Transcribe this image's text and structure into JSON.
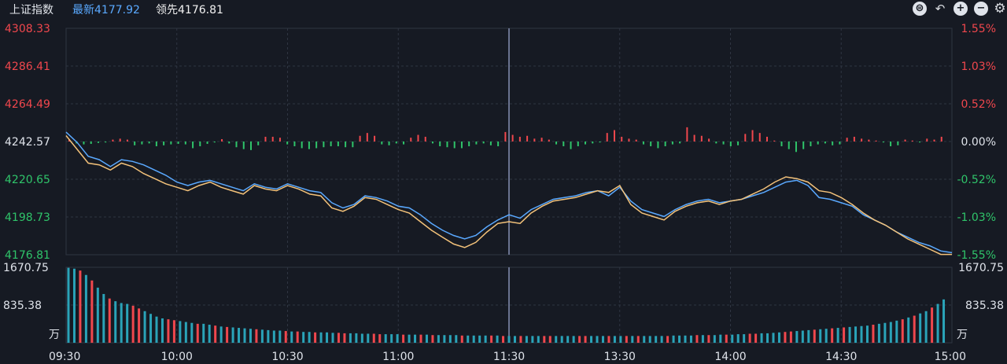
{
  "header": {
    "title": "上证指数",
    "latest_label": "最新4177.92",
    "leading_label": "领先4176.81"
  },
  "toolbar": {
    "icons": [
      "scale-icon",
      "undo-icon",
      "zoom-in-icon",
      "zoom-out-icon",
      "settings-icon"
    ]
  },
  "colors": {
    "background": "#161a23",
    "up": "#f0474d",
    "down": "#2fc46a",
    "index_line": "#5aa9ff",
    "leading_line": "#f3c27a",
    "volume": "#2aa3b8",
    "grid": "#2f3542"
  },
  "chart_data": {
    "type": "line",
    "price_axis": {
      "ticks_left": [
        "4308.33",
        "4286.41",
        "4264.49",
        "4242.57",
        "4220.65",
        "4198.73",
        "4176.81"
      ],
      "ticks_right": [
        "1.55%",
        "1.03%",
        "0.52%",
        "0.00%",
        "-0.52%",
        "-1.03%",
        "-1.55%"
      ],
      "ylim": [
        4176.81,
        4308.33
      ],
      "base": 4242.57
    },
    "volume_axis": {
      "ticks": [
        "1670.75",
        "835.38"
      ],
      "unit": "万",
      "ylim": [
        0,
        1670.75
      ]
    },
    "x_ticks": [
      "09:30",
      "10:00",
      "10:30",
      "11:00",
      "11:30",
      "13:30",
      "14:00",
      "14:30",
      "15:00"
    ],
    "x_minutes": [
      0,
      30,
      60,
      90,
      120,
      150,
      180,
      210,
      240
    ],
    "series": [
      {
        "name": "最新",
        "points": [
          [
            0,
            4248
          ],
          [
            3,
            4242
          ],
          [
            6,
            4234
          ],
          [
            9,
            4232
          ],
          [
            12,
            4228
          ],
          [
            15,
            4232
          ],
          [
            18,
            4231
          ],
          [
            21,
            4229
          ],
          [
            24,
            4226
          ],
          [
            27,
            4223
          ],
          [
            30,
            4219
          ],
          [
            33,
            4217
          ],
          [
            36,
            4219
          ],
          [
            39,
            4220
          ],
          [
            42,
            4218
          ],
          [
            45,
            4216
          ],
          [
            48,
            4214
          ],
          [
            51,
            4218
          ],
          [
            54,
            4216
          ],
          [
            57,
            4215
          ],
          [
            60,
            4218
          ],
          [
            63,
            4216
          ],
          [
            66,
            4214
          ],
          [
            69,
            4213
          ],
          [
            72,
            4207
          ],
          [
            75,
            4204
          ],
          [
            78,
            4206
          ],
          [
            81,
            4211
          ],
          [
            84,
            4210
          ],
          [
            87,
            4208
          ],
          [
            90,
            4205
          ],
          [
            93,
            4204
          ],
          [
            96,
            4200
          ],
          [
            99,
            4195
          ],
          [
            102,
            4191
          ],
          [
            105,
            4188
          ],
          [
            108,
            4186
          ],
          [
            111,
            4188
          ],
          [
            114,
            4193
          ],
          [
            117,
            4197
          ],
          [
            120,
            4200
          ],
          [
            123,
            4198
          ],
          [
            126,
            4203
          ],
          [
            129,
            4206
          ],
          [
            132,
            4209
          ],
          [
            135,
            4210
          ],
          [
            138,
            4211
          ],
          [
            141,
            4213
          ],
          [
            144,
            4214
          ],
          [
            147,
            4211
          ],
          [
            150,
            4216
          ],
          [
            153,
            4208
          ],
          [
            156,
            4203
          ],
          [
            159,
            4201
          ],
          [
            162,
            4199
          ],
          [
            165,
            4203
          ],
          [
            168,
            4206
          ],
          [
            171,
            4208
          ],
          [
            174,
            4209
          ],
          [
            177,
            4207
          ],
          [
            180,
            4208
          ],
          [
            183,
            4209
          ],
          [
            186,
            4211
          ],
          [
            189,
            4213
          ],
          [
            192,
            4216
          ],
          [
            195,
            4219
          ],
          [
            198,
            4220
          ],
          [
            201,
            4217
          ],
          [
            204,
            4210
          ],
          [
            207,
            4209
          ],
          [
            210,
            4207
          ],
          [
            213,
            4205
          ],
          [
            216,
            4200
          ],
          [
            219,
            4197
          ],
          [
            222,
            4194
          ],
          [
            225,
            4190
          ],
          [
            228,
            4187
          ],
          [
            231,
            4184
          ],
          [
            234,
            4182
          ],
          [
            237,
            4179
          ],
          [
            240,
            4178
          ]
        ]
      },
      {
        "name": "领先",
        "points": [
          [
            0,
            4246
          ],
          [
            3,
            4238
          ],
          [
            6,
            4230
          ],
          [
            9,
            4229
          ],
          [
            12,
            4226
          ],
          [
            15,
            4230
          ],
          [
            18,
            4228
          ],
          [
            21,
            4224
          ],
          [
            24,
            4221
          ],
          [
            27,
            4218
          ],
          [
            30,
            4216
          ],
          [
            33,
            4214
          ],
          [
            36,
            4217
          ],
          [
            39,
            4219
          ],
          [
            42,
            4216
          ],
          [
            45,
            4214
          ],
          [
            48,
            4212
          ],
          [
            51,
            4217
          ],
          [
            54,
            4215
          ],
          [
            57,
            4214
          ],
          [
            60,
            4217
          ],
          [
            63,
            4215
          ],
          [
            66,
            4212
          ],
          [
            69,
            4211
          ],
          [
            72,
            4204
          ],
          [
            75,
            4202
          ],
          [
            78,
            4205
          ],
          [
            81,
            4210
          ],
          [
            84,
            4209
          ],
          [
            87,
            4206
          ],
          [
            90,
            4203
          ],
          [
            93,
            4201
          ],
          [
            96,
            4196
          ],
          [
            99,
            4191
          ],
          [
            102,
            4187
          ],
          [
            105,
            4183
          ],
          [
            108,
            4181
          ],
          [
            111,
            4184
          ],
          [
            114,
            4190
          ],
          [
            117,
            4195
          ],
          [
            120,
            4196
          ],
          [
            123,
            4195
          ],
          [
            126,
            4201
          ],
          [
            129,
            4205
          ],
          [
            132,
            4208
          ],
          [
            135,
            4209
          ],
          [
            138,
            4210
          ],
          [
            141,
            4212
          ],
          [
            144,
            4214
          ],
          [
            147,
            4213
          ],
          [
            150,
            4217
          ],
          [
            153,
            4206
          ],
          [
            156,
            4201
          ],
          [
            159,
            4199
          ],
          [
            162,
            4197
          ],
          [
            165,
            4202
          ],
          [
            168,
            4205
          ],
          [
            171,
            4207
          ],
          [
            174,
            4208
          ],
          [
            177,
            4206
          ],
          [
            180,
            4208
          ],
          [
            183,
            4209
          ],
          [
            186,
            4212
          ],
          [
            189,
            4215
          ],
          [
            192,
            4219
          ],
          [
            195,
            4222
          ],
          [
            198,
            4221
          ],
          [
            201,
            4219
          ],
          [
            204,
            4214
          ],
          [
            207,
            4213
          ],
          [
            210,
            4210
          ],
          [
            213,
            4206
          ],
          [
            216,
            4201
          ],
          [
            219,
            4197
          ],
          [
            222,
            4194
          ],
          [
            225,
            4190
          ],
          [
            228,
            4186
          ],
          [
            231,
            4183
          ],
          [
            234,
            4180
          ],
          [
            237,
            4177
          ],
          [
            240,
            4177
          ]
        ]
      }
    ],
    "diff_bars_pct": [
      0.05,
      -0.04,
      -0.06,
      -0.05,
      -0.03,
      -0.02,
      0.04,
      0.06,
      0.04,
      -0.08,
      -0.06,
      -0.04,
      -0.1,
      -0.08,
      -0.06,
      -0.05,
      -0.06,
      -0.14,
      -0.1,
      -0.05,
      -0.02,
      0.05,
      -0.04,
      -0.12,
      -0.16,
      -0.18,
      -0.08,
      0.1,
      0.1,
      0.08,
      -0.06,
      -0.1,
      -0.14,
      -0.16,
      -0.14,
      -0.12,
      -0.1,
      -0.1,
      -0.12,
      -0.12,
      0.12,
      0.18,
      0.12,
      -0.06,
      -0.08,
      -0.04,
      -0.06,
      0.08,
      0.14,
      0.1,
      -0.04,
      -0.1,
      -0.12,
      -0.14,
      -0.14,
      -0.1,
      -0.06,
      -0.04,
      -0.08,
      -0.1,
      0.2,
      0.14,
      0.1,
      0.12,
      0.06,
      0.08,
      0.04,
      -0.06,
      -0.1,
      -0.16,
      -0.1,
      -0.06,
      -0.04,
      -0.02,
      0.18,
      0.24,
      0.1,
      0.06,
      0.04,
      -0.06,
      -0.1,
      -0.14,
      -0.1,
      -0.06,
      -0.04,
      0.3,
      0.14,
      0.12,
      0.06,
      -0.04,
      -0.06,
      -0.1,
      -0.08,
      0.16,
      0.24,
      0.18,
      0.1,
      0.02,
      -0.1,
      -0.16,
      -0.22,
      -0.16,
      -0.1,
      -0.06,
      -0.04,
      -0.08,
      -0.06,
      0.08,
      0.1,
      0.06,
      0.04,
      0.02,
      -0.02,
      -0.1,
      -0.08,
      0.04,
      0.02,
      -0.02,
      0.06,
      0.04,
      0.1
    ],
    "volumes": [
      1660,
      1640,
      1600,
      1500,
      1380,
      1220,
      1080,
      980,
      920,
      880,
      860,
      820,
      760,
      700,
      640,
      580,
      540,
      520,
      500,
      480,
      460,
      440,
      420,
      420,
      400,
      380,
      360,
      350,
      340,
      330,
      320,
      310,
      300,
      290,
      280,
      270,
      270,
      260,
      250,
      250,
      240,
      240,
      230,
      230,
      230,
      220,
      220,
      210,
      210,
      210,
      200,
      200,
      200,
      190,
      190,
      190,
      190,
      180,
      180,
      180,
      180,
      180,
      170,
      170,
      170,
      170,
      170,
      160,
      160,
      160,
      160,
      160,
      160,
      160,
      150,
      150,
      150,
      150,
      150,
      150,
      150,
      150,
      150,
      150,
      150,
      150,
      150,
      150,
      150,
      150,
      150,
      150,
      150,
      150,
      150,
      150,
      150,
      150,
      150,
      150,
      150,
      150,
      150,
      160,
      160,
      160,
      160,
      170,
      170,
      170,
      170,
      180,
      180,
      180,
      190,
      190,
      200,
      200,
      210,
      210,
      220,
      230,
      240,
      250,
      260,
      270,
      280,
      290,
      300,
      310,
      320,
      330,
      340,
      350,
      360,
      370,
      380,
      400,
      420,
      440,
      460,
      490,
      520,
      560,
      600,
      650,
      700,
      780,
      860,
      960
    ],
    "legend": [
      "最新4177.92",
      "领先4176.81"
    ]
  }
}
